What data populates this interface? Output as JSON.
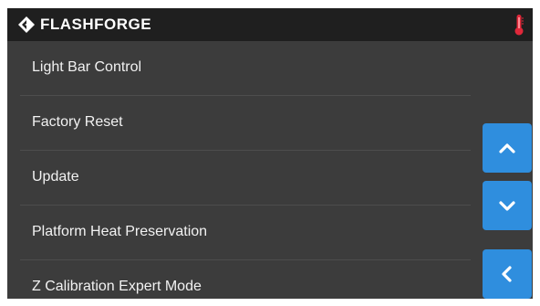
{
  "header": {
    "brand": "FLASHFORGE",
    "logo_icon": "flashforge-logo-icon",
    "status_icon": "thermometer-icon",
    "status_color": "#e0283a"
  },
  "menu": {
    "items": [
      {
        "label": "Light Bar Control"
      },
      {
        "label": "Factory Reset"
      },
      {
        "label": "Update"
      },
      {
        "label": "Platform Heat Preservation"
      },
      {
        "label": "Z Calibration Expert Mode"
      }
    ]
  },
  "controls": {
    "scroll_up_icon": "chevron-up-icon",
    "scroll_down_icon": "chevron-down-icon",
    "back_icon": "chevron-left-icon",
    "accent": "#2f8ede"
  }
}
